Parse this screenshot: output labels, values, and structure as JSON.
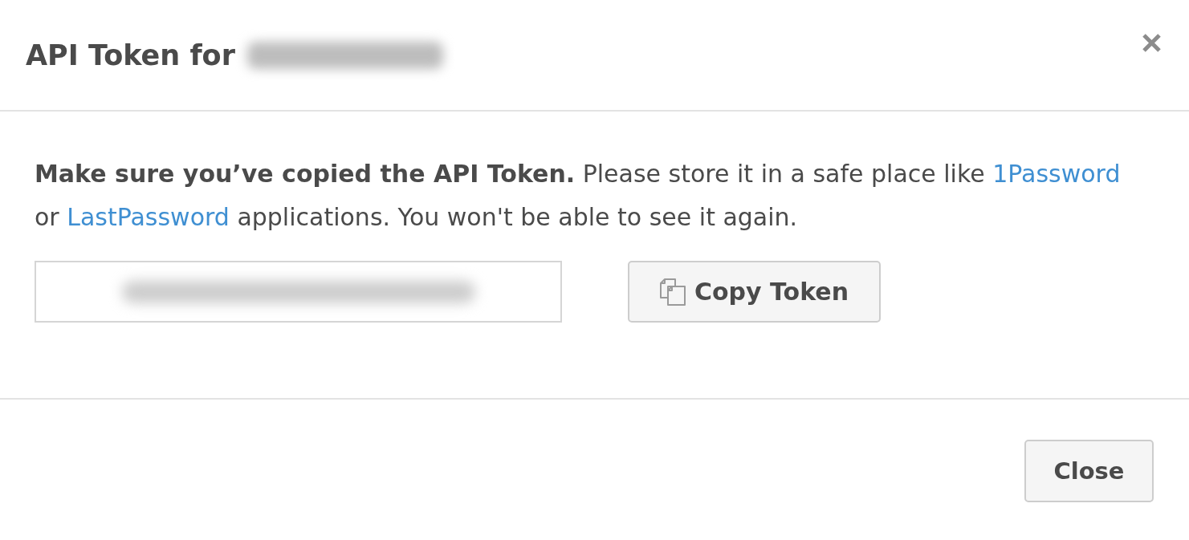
{
  "dialog": {
    "title": "API Token for",
    "message": [
      {
        "kind": "text",
        "text": "**Make sure you’ve copied the API Token.** Please store it in a safe place like "
      },
      {
        "kind": "link",
        "text": "1Password"
      },
      {
        "kind": "text",
        "text": " or "
      },
      {
        "kind": "link",
        "text": "LastPassword"
      },
      {
        "kind": "text",
        "text": " applications. You won't be able to see it again."
      }
    ],
    "copy_button": {
      "label": "Copy Token"
    },
    "footer_buttons": [
      {
        "label": "Close"
      }
    ]
  }
}
